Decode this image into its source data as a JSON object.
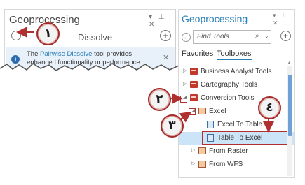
{
  "left_panel": {
    "title": "Geoprocessing",
    "window_controls": "▾ ⊥ ✕",
    "back_icon": "back-arrow-icon",
    "tool_name": "Dissolve",
    "add_icon": "plus-circle-icon",
    "info_icon": "info-icon",
    "info_prefix": "The ",
    "info_link": "Pairwise Dissolve",
    "info_suffix": " tool provides enhanced functionality or performance.",
    "close": "✕"
  },
  "callouts": [
    "١",
    "٢",
    "٣",
    "٤"
  ],
  "right_panel": {
    "title": "Geoprocessing",
    "window_controls": "▾ ⊥ ✕",
    "search_placeholder": "Find Tools",
    "search_icon": "search-icon",
    "tabs": [
      "Favorites",
      "Toolboxes"
    ],
    "active_tab": "Toolboxes",
    "tree": [
      {
        "label": "Business Analyst Tools",
        "level": 0,
        "icon": "toolbox-icon",
        "expander": "▷"
      },
      {
        "label": "Cartography Tools",
        "level": 0,
        "icon": "toolbox-icon",
        "expander": "▷"
      },
      {
        "label": "Conversion Tools",
        "level": 0,
        "icon": "toolbox-icon",
        "expander": "◢"
      },
      {
        "label": "Excel",
        "level": 1,
        "icon": "toolset-icon",
        "expander": "◢"
      },
      {
        "label": "Excel To Table",
        "level": 2,
        "icon": "tool-icon",
        "expander": ""
      },
      {
        "label": "Table To Excel",
        "level": 2,
        "icon": "tool-icon",
        "expander": "",
        "selected": true
      },
      {
        "label": "From Raster",
        "level": 1,
        "icon": "toolset-icon",
        "expander": "▷"
      },
      {
        "label": "From WFS",
        "level": 1,
        "icon": "toolset-icon",
        "expander": "▷"
      }
    ]
  },
  "colors": {
    "accent": "#2a7fb8",
    "callout_border": "#a52a2a",
    "info_bg": "#e8f1f9",
    "selection": "#cce4f7"
  }
}
